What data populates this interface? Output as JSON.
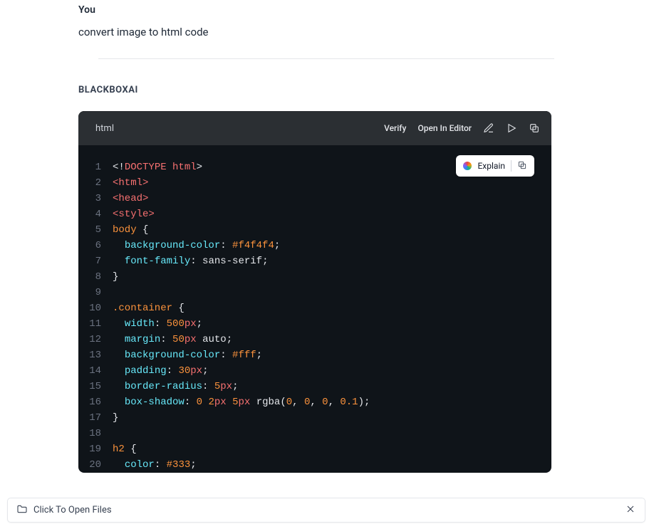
{
  "user": {
    "label": "You",
    "message": "convert image to html code"
  },
  "assistant": {
    "label": "BLACKBOXAI"
  },
  "codeblock": {
    "language": "html",
    "toolbar": {
      "verify": "Verify",
      "open_in_editor": "Open In Editor"
    },
    "explain": {
      "label": "Explain"
    },
    "lines": [
      {
        "num": "1",
        "tokens": [
          [
            "<!",
            "white"
          ],
          [
            "DOCTYPE html",
            "red"
          ],
          [
            ">",
            "white"
          ]
        ]
      },
      {
        "num": "2",
        "tokens": [
          [
            "<html>",
            "red"
          ]
        ]
      },
      {
        "num": "3",
        "tokens": [
          [
            "<head>",
            "red"
          ]
        ]
      },
      {
        "num": "4",
        "tokens": [
          [
            "<style>",
            "red"
          ]
        ]
      },
      {
        "num": "5",
        "tokens": [
          [
            "body",
            "orange"
          ],
          [
            " ",
            "white"
          ],
          [
            "{",
            "white"
          ]
        ]
      },
      {
        "num": "6",
        "tokens": [
          [
            "  ",
            "white"
          ],
          [
            "background-color",
            "cyan"
          ],
          [
            ": ",
            "white"
          ],
          [
            "#f4f4f4",
            "orange"
          ],
          [
            ";",
            "white"
          ]
        ]
      },
      {
        "num": "7",
        "tokens": [
          [
            "  ",
            "white"
          ],
          [
            "font-family",
            "cyan"
          ],
          [
            ": ",
            "white"
          ],
          [
            "sans-serif",
            "white"
          ],
          [
            ";",
            "white"
          ]
        ]
      },
      {
        "num": "8",
        "tokens": [
          [
            "}",
            "white"
          ]
        ]
      },
      {
        "num": "9",
        "tokens": [
          [
            "",
            "white"
          ]
        ]
      },
      {
        "num": "10",
        "tokens": [
          [
            ".container",
            "orange"
          ],
          [
            " ",
            "white"
          ],
          [
            "{",
            "white"
          ]
        ]
      },
      {
        "num": "11",
        "tokens": [
          [
            "  ",
            "white"
          ],
          [
            "width",
            "cyan"
          ],
          [
            ": ",
            "white"
          ],
          [
            "500",
            "orange"
          ],
          [
            "px",
            "red"
          ],
          [
            ";",
            "white"
          ]
        ]
      },
      {
        "num": "12",
        "tokens": [
          [
            "  ",
            "white"
          ],
          [
            "margin",
            "cyan"
          ],
          [
            ": ",
            "white"
          ],
          [
            "50",
            "orange"
          ],
          [
            "px",
            "red"
          ],
          [
            " ",
            "white"
          ],
          [
            "auto",
            "white"
          ],
          [
            ";",
            "white"
          ]
        ]
      },
      {
        "num": "13",
        "tokens": [
          [
            "  ",
            "white"
          ],
          [
            "background-color",
            "cyan"
          ],
          [
            ": ",
            "white"
          ],
          [
            "#fff",
            "orange"
          ],
          [
            ";",
            "white"
          ]
        ]
      },
      {
        "num": "14",
        "tokens": [
          [
            "  ",
            "white"
          ],
          [
            "padding",
            "cyan"
          ],
          [
            ": ",
            "white"
          ],
          [
            "30",
            "orange"
          ],
          [
            "px",
            "red"
          ],
          [
            ";",
            "white"
          ]
        ]
      },
      {
        "num": "15",
        "tokens": [
          [
            "  ",
            "white"
          ],
          [
            "border-radius",
            "cyan"
          ],
          [
            ": ",
            "white"
          ],
          [
            "5",
            "orange"
          ],
          [
            "px",
            "red"
          ],
          [
            ";",
            "white"
          ]
        ]
      },
      {
        "num": "16",
        "tokens": [
          [
            "  ",
            "white"
          ],
          [
            "box-shadow",
            "cyan"
          ],
          [
            ": ",
            "white"
          ],
          [
            "0",
            "orange"
          ],
          [
            " ",
            "white"
          ],
          [
            "2",
            "orange"
          ],
          [
            "px",
            "red"
          ],
          [
            " ",
            "white"
          ],
          [
            "5",
            "orange"
          ],
          [
            "px",
            "red"
          ],
          [
            " ",
            "white"
          ],
          [
            "rgba",
            "white"
          ],
          [
            "(",
            "white"
          ],
          [
            "0",
            "orange"
          ],
          [
            ", ",
            "white"
          ],
          [
            "0",
            "orange"
          ],
          [
            ", ",
            "white"
          ],
          [
            "0",
            "orange"
          ],
          [
            ", ",
            "white"
          ],
          [
            "0.1",
            "orange"
          ],
          [
            ")",
            "white"
          ],
          [
            ";",
            "white"
          ]
        ]
      },
      {
        "num": "17",
        "tokens": [
          [
            "}",
            "white"
          ]
        ]
      },
      {
        "num": "18",
        "tokens": [
          [
            "",
            "white"
          ]
        ]
      },
      {
        "num": "19",
        "tokens": [
          [
            "h2",
            "orange"
          ],
          [
            " ",
            "white"
          ],
          [
            "{",
            "white"
          ]
        ]
      },
      {
        "num": "20",
        "tokens": [
          [
            "  ",
            "white"
          ],
          [
            "color",
            "cyan"
          ],
          [
            ": ",
            "white"
          ],
          [
            "#333",
            "orange"
          ],
          [
            ";",
            "white"
          ]
        ]
      }
    ]
  },
  "filebar": {
    "label": "Click To Open Files"
  }
}
